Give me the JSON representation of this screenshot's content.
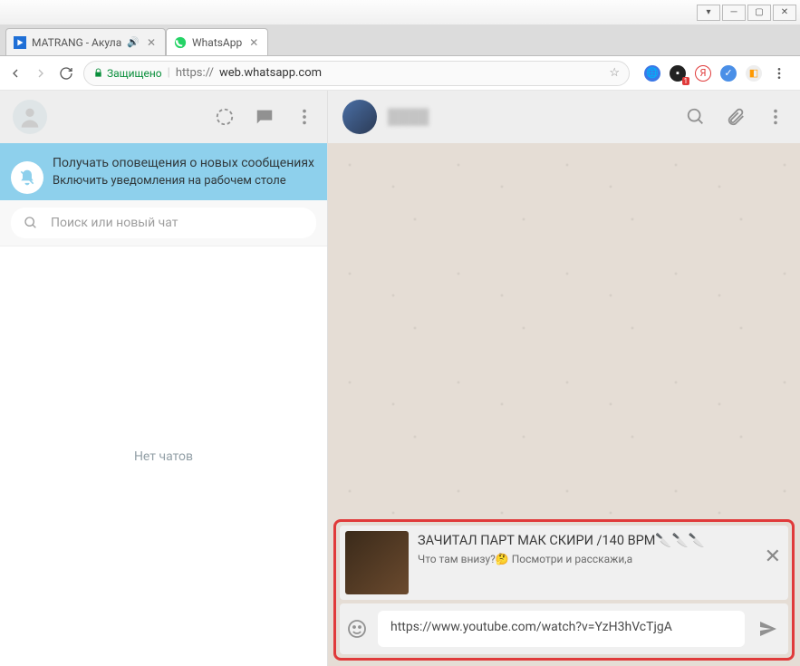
{
  "window": {
    "buttons": {
      "min": "─",
      "max": "▢",
      "close": "✕",
      "down": "▾"
    }
  },
  "tabs": [
    {
      "title": "MATRANG - Акула",
      "muted": true
    },
    {
      "title": "WhatsApp",
      "muted": false
    }
  ],
  "browser": {
    "secure_label": "Защищено",
    "url_scheme": "https://",
    "url_rest": "web.whatsapp.com"
  },
  "sidebar": {
    "notif_title": "Получать оповещения о новых сообщениях",
    "notif_sub": "Включить уведомления на рабочем столе",
    "search_placeholder": "Поиск или новый чат",
    "empty_label": "Нет чатов"
  },
  "chat": {
    "contact_name": "████"
  },
  "compose": {
    "preview_title": "ЗАЧИТАЛ ПАРТ МАК СКИРИ /140 BPM🔪🔪🔪",
    "preview_sub": "Что там внизу?🤔 Посмотри и расскажи,а",
    "input_value": "https://www.youtube.com/watch?v=YzH3hVcTjgA"
  }
}
